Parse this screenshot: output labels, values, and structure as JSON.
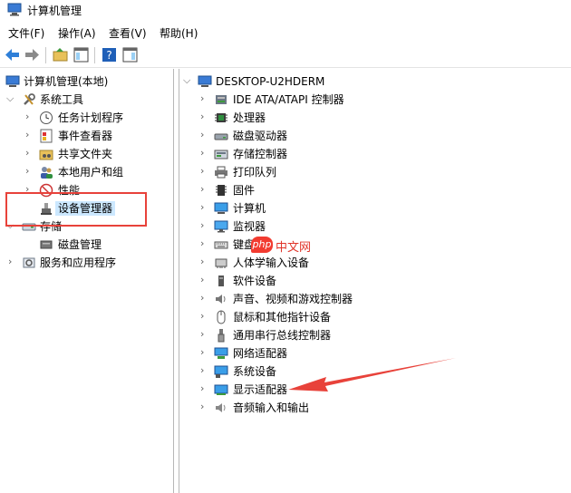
{
  "window": {
    "title": "计算机管理"
  },
  "menu": [
    "文件(F)",
    "操作(A)",
    "查看(V)",
    "帮助(H)"
  ],
  "left_tree": {
    "root": "计算机管理(本地)",
    "system_tools": "系统工具",
    "items": [
      "任务计划程序",
      "事件查看器",
      "共享文件夹",
      "本地用户和组",
      "性能",
      "设备管理器"
    ],
    "storage": "存储",
    "disk_mgmt": "磁盘管理",
    "services": "服务和应用程序"
  },
  "right_tree": {
    "root": "DESKTOP-U2HDERM",
    "devices": [
      {
        "label": "IDE ATA/ATAPI 控制器",
        "icon": "ide-controller-icon"
      },
      {
        "label": "处理器",
        "icon": "processor-icon"
      },
      {
        "label": "磁盘驱动器",
        "icon": "disk-drive-icon"
      },
      {
        "label": "存储控制器",
        "icon": "storage-controller-icon"
      },
      {
        "label": "打印队列",
        "icon": "printer-icon"
      },
      {
        "label": "固件",
        "icon": "firmware-icon"
      },
      {
        "label": "计算机",
        "icon": "computer-icon"
      },
      {
        "label": "监视器",
        "icon": "monitor-icon"
      },
      {
        "label": "键盘",
        "icon": "keyboard-icon"
      },
      {
        "label": "人体学输入设备",
        "icon": "hid-icon"
      },
      {
        "label": "软件设备",
        "icon": "software-device-icon"
      },
      {
        "label": "声音、视频和游戏控制器",
        "icon": "sound-icon"
      },
      {
        "label": "鼠标和其他指针设备",
        "icon": "mouse-icon"
      },
      {
        "label": "通用串行总线控制器",
        "icon": "usb-icon"
      },
      {
        "label": "网络适配器",
        "icon": "network-adapter-icon"
      },
      {
        "label": "系统设备",
        "icon": "system-device-icon"
      },
      {
        "label": "显示适配器",
        "icon": "display-adapter-icon"
      },
      {
        "label": "音频输入和输出",
        "icon": "audio-io-icon"
      }
    ]
  },
  "watermark": {
    "badge": "php",
    "text": "中文网"
  },
  "colors": {
    "selection": "#cce8ff",
    "annotation_red": "#e8423a"
  }
}
